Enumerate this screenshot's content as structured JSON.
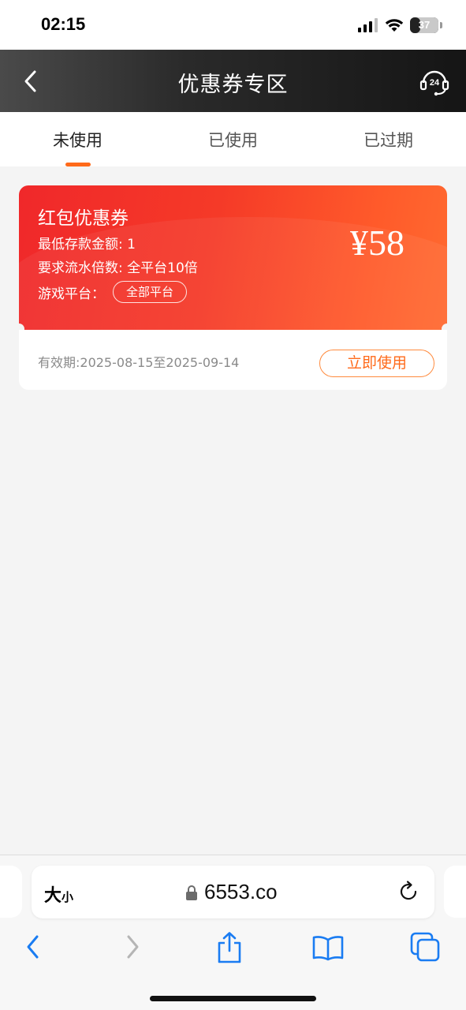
{
  "status_bar": {
    "time": "02:15",
    "battery": "37",
    "battery_level": 0.37
  },
  "header": {
    "title": "优惠券专区",
    "back_icon": "chevron-left-icon",
    "service_icon": "headset-24-icon"
  },
  "tabs": [
    {
      "label": "未使用",
      "active": true
    },
    {
      "label": "已使用",
      "active": false
    },
    {
      "label": "已过期",
      "active": false
    }
  ],
  "coupon": {
    "title": "红包优惠券",
    "min_deposit": "最低存款金额: 1",
    "turnover": "要求流水倍数: 全平台10倍",
    "platform_label": "游戏平台：",
    "platform_value": "全部平台",
    "amount": "¥58",
    "validity": "有效期:2025-08-15至2025-09-14",
    "use_button": "立即使用"
  },
  "browser": {
    "text_size_big": "大",
    "text_size_small": "小",
    "url": "6553.co"
  },
  "colors": {
    "accent": "#ff6a1a",
    "coupon_red": "#f0282a",
    "coupon_orange": "#ff6a30",
    "header_dark": "#1a1a1a",
    "ios_blue": "#1a7cf2"
  }
}
